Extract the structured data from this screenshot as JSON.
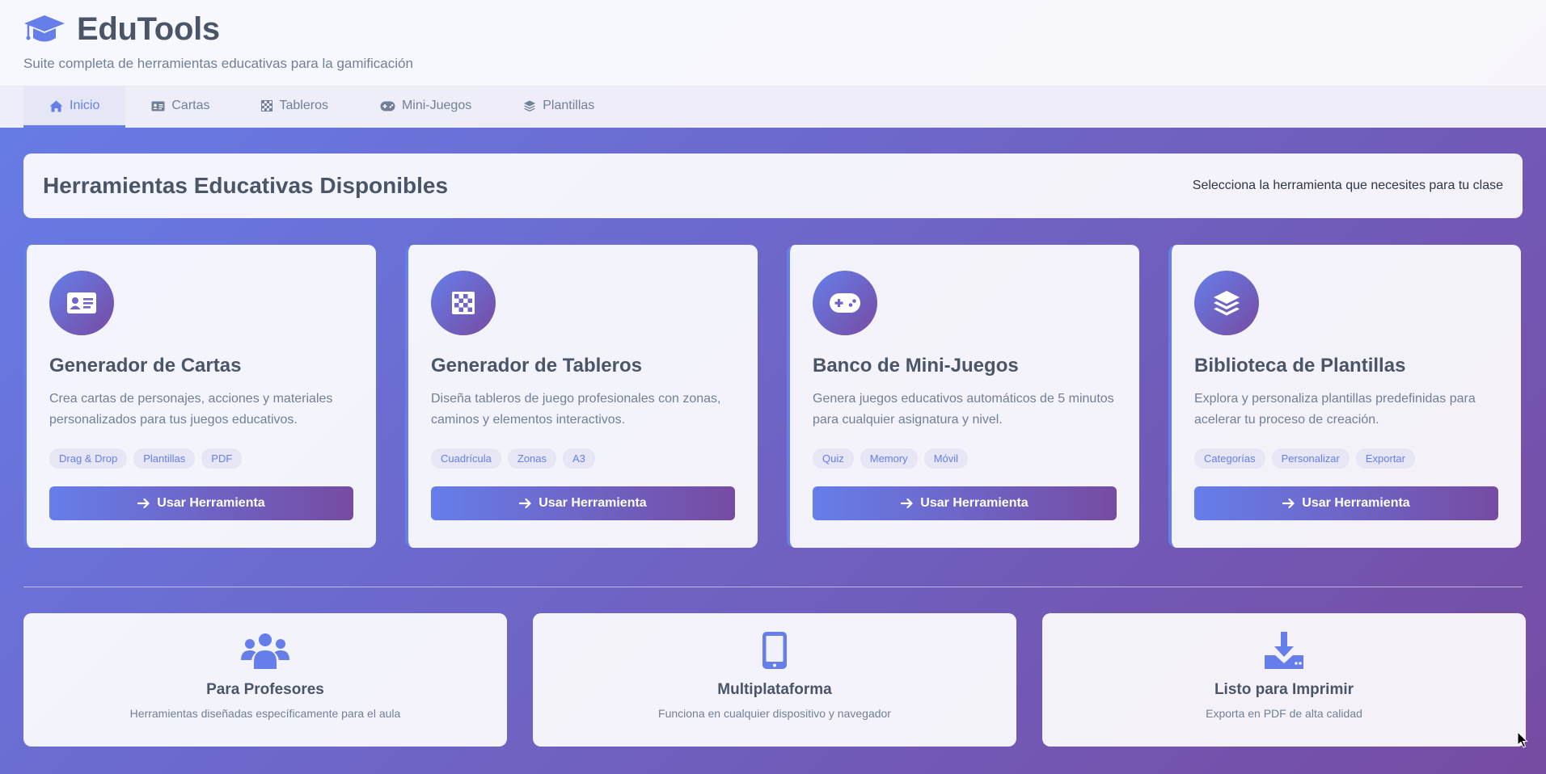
{
  "app": {
    "title": "EduTools",
    "subtitle": "Suite completa de herramientas educativas para la gamificación",
    "logo_icon": "graduation-cap-icon"
  },
  "nav": {
    "tabs": [
      {
        "label": "Inicio",
        "icon": "home-icon",
        "active": true
      },
      {
        "label": "Cartas",
        "icon": "id-card-icon",
        "active": false
      },
      {
        "label": "Tableros",
        "icon": "chess-board-icon",
        "active": false
      },
      {
        "label": "Mini-Juegos",
        "icon": "gamepad-icon",
        "active": false
      },
      {
        "label": "Plantillas",
        "icon": "layer-group-icon",
        "active": false
      }
    ]
  },
  "section": {
    "title": "Herramientas Educativas Disponibles",
    "hint": "Selecciona la herramienta que necesites para tu clase"
  },
  "tools": [
    {
      "title": "Generador de Cartas",
      "description": "Crea cartas de personajes, acciones y materiales personalizados para tus juegos educativos.",
      "tags": [
        "Drag & Drop",
        "Plantillas",
        "PDF"
      ],
      "button": "Usar Herramienta",
      "icon": "id-card-icon"
    },
    {
      "title": "Generador de Tableros",
      "description": "Diseña tableros de juego profesionales con zonas, caminos y elementos interactivos.",
      "tags": [
        "Cuadrícula",
        "Zonas",
        "A3"
      ],
      "button": "Usar Herramienta",
      "icon": "chess-board-icon"
    },
    {
      "title": "Banco de Mini-Juegos",
      "description": "Genera juegos educativos automáticos de 5 minutos para cualquier asignatura y nivel.",
      "tags": [
        "Quiz",
        "Memory",
        "Móvil"
      ],
      "button": "Usar Herramienta",
      "icon": "gamepad-icon"
    },
    {
      "title": "Biblioteca de Plantillas",
      "description": "Explora y personaliza plantillas predefinidas para acelerar tu proceso de creación.",
      "tags": [
        "Categorías",
        "Personalizar",
        "Exportar"
      ],
      "button": "Usar Herramienta",
      "icon": "layer-group-icon"
    }
  ],
  "features": [
    {
      "title": "Para Profesores",
      "description": "Herramientas diseñadas específicamente para el aula",
      "icon": "users-icon"
    },
    {
      "title": "Multiplataforma",
      "description": "Funciona en cualquier dispositivo y navegador",
      "icon": "mobile-icon"
    },
    {
      "title": "Listo para Imprimir",
      "description": "Exporta en PDF de alta calidad",
      "icon": "download-icon"
    }
  ],
  "colors": {
    "accent": "#667eea",
    "accent_dark": "#764ba2",
    "heading": "#4a5568",
    "muted": "#718096"
  }
}
